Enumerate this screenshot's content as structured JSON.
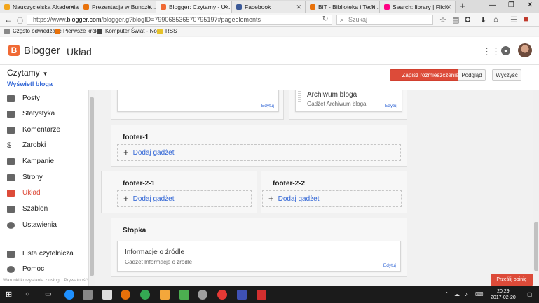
{
  "browser": {
    "tabs": [
      {
        "title": "Nauczycielska Akademia I...",
        "color": "#f2a51a"
      },
      {
        "title": "Prezentacja w Buncze...",
        "color": "#e8710a"
      },
      {
        "title": "Blogger: Czytamy - Uk...",
        "color": "#f06a35"
      },
      {
        "title": "Facebook",
        "color": "#3b5998"
      },
      {
        "title": "BiT - Biblioteka i Tech...",
        "color": "#e8710a"
      },
      {
        "title": "Search: library | Flickr",
        "color": "#ff0084"
      }
    ],
    "url_prefix": "https://www.",
    "url_host": "blogger.com",
    "url_rest": "/blogger.g?blogID=7990685365707951​97#pageelements",
    "search_placeholder": "Szukaj",
    "bookmarks": [
      "Często odwiedzane",
      "Pierwsze kroki",
      "Komputer Świat - No...",
      "RSS"
    ]
  },
  "header": {
    "brand": "Blogger",
    "section": "Układ"
  },
  "subbar": {
    "blog_name": "Czytamy",
    "view_blog": "Wyświetl bloga",
    "save_label": "Zapisz rozmieszczenie",
    "preview_label": "Podgląd",
    "clear_label": "Wyczyść"
  },
  "sidebar": {
    "items": [
      {
        "label": "Posty",
        "icon": "posts-icon"
      },
      {
        "label": "Statystyka",
        "icon": "stats-icon"
      },
      {
        "label": "Komentarze",
        "icon": "comments-icon"
      },
      {
        "label": "Zarobki",
        "icon": "dollar-icon"
      },
      {
        "label": "Kampanie",
        "icon": "campaign-icon"
      },
      {
        "label": "Strony",
        "icon": "pages-icon"
      },
      {
        "label": "Układ",
        "icon": "layout-icon",
        "active": true
      },
      {
        "label": "Szablon",
        "icon": "template-icon"
      },
      {
        "label": "Ustawienia",
        "icon": "settings-icon"
      },
      {
        "label": "Lista czytelnicza",
        "icon": "reading-list-icon"
      },
      {
        "label": "Pomoc",
        "icon": "help-icon"
      }
    ],
    "footer": "Warunki korzystania z usługi  |  Prywatność"
  },
  "layout": {
    "top_left_edit": "Edytuj",
    "archive": {
      "name": "Archiwum bloga",
      "sub": "Gadżet Archiwum bloga",
      "edit": "Edytuj"
    },
    "footer1": {
      "title": "footer-1",
      "add": "Dodaj gadżet"
    },
    "footer21": {
      "title": "footer-2-1",
      "add": "Dodaj gadżet"
    },
    "footer22": {
      "title": "footer-2-2",
      "add": "Dodaj gadżet"
    },
    "stopka": {
      "title": "Stopka",
      "gadget_name": "Informacje o źródle",
      "gadget_sub": "Gadżet Informacje o źródle",
      "edit": "Edytuj"
    }
  },
  "feedback_label": "Prześlij opinię",
  "taskbar": {
    "time": "20:29",
    "date": "2017-02-20"
  },
  "colors": {
    "accent": "#dd4b39",
    "brand": "#f06a35",
    "link": "#3367d6"
  }
}
